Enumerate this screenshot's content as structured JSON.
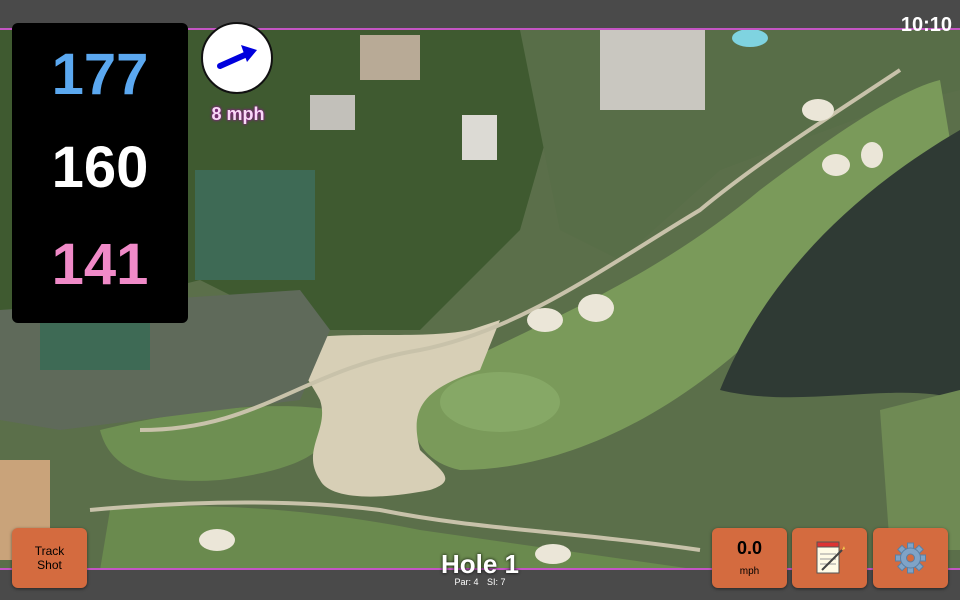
{
  "clock": "10:10",
  "distances": {
    "back": "177",
    "center": "160",
    "front": "141"
  },
  "wind": {
    "speed": "8 mph",
    "direction_icon": "wind-arrow-icon"
  },
  "hole": {
    "title": "Hole 1",
    "par": "Par: 4",
    "stroke_index": "SI: 7"
  },
  "buttons": {
    "track_shot": [
      "Track",
      "Shot"
    ],
    "speed_value": "0.0",
    "speed_unit": "mph",
    "notes_icon": "notepad-icon",
    "settings_icon": "gear-icon"
  },
  "colors": {
    "back_distance": "#5ba8f0",
    "center_distance": "#ffffff",
    "front_distance": "#f08ac8",
    "button": "#d46b3f",
    "accent_border": "#c455c4"
  }
}
